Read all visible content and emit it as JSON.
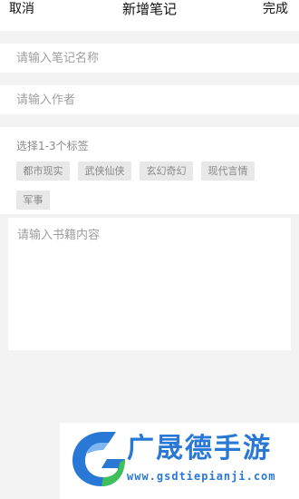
{
  "header": {
    "cancel_label": "取消",
    "title": "新增笔记",
    "done_label": "完成"
  },
  "form": {
    "name_placeholder": "请输入笔记名称",
    "author_placeholder": "请输入作者",
    "tags_label": "选择1-3个标签",
    "tags": [
      "都市现实",
      "武侠仙侠",
      "玄幻奇幻",
      "现代言情",
      "军事"
    ],
    "content_placeholder": "请输入书籍内容"
  },
  "watermark": {
    "brand": "广晟德手游",
    "url": "www.gsdtiepianji.com"
  },
  "colors": {
    "background": "#f3f3f3",
    "card": "#ffffff",
    "tag_bg": "#e8e8e8",
    "watermark_blue": "#2a78d6",
    "watermark_green": "#3fbf5a"
  },
  "icons": {
    "watermark_logo": "brand-logo-icon"
  }
}
